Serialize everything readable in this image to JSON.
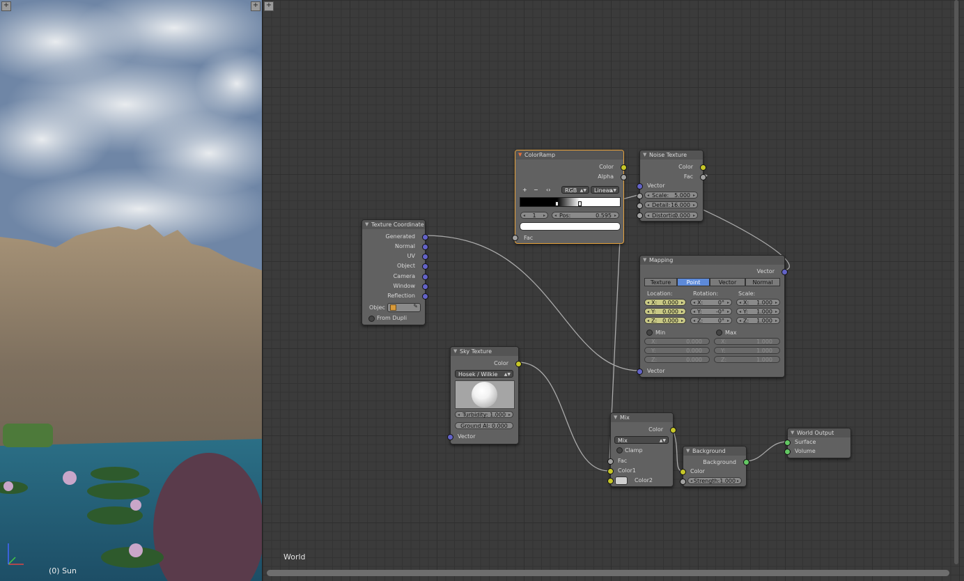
{
  "viewport": {
    "label": "(0) Sun"
  },
  "editor": {
    "world_label": "World"
  },
  "nodes": {
    "color_ramp": {
      "title": "ColorRamp",
      "out_color": "Color",
      "out_alpha": "Alpha",
      "btn_add": "+",
      "btn_remove": "−",
      "btn_flip": "‹›",
      "mode": "RGB",
      "interpolation": "Linear",
      "index": "1",
      "pos_label": "Pos:",
      "pos_value": "0.595",
      "in_fac": "Fac"
    },
    "noise_texture": {
      "title": "Noise Texture",
      "out_color": "Color",
      "out_fac": "Fac",
      "in_vector": "Vector",
      "scale_label": "Scale:",
      "scale_value": "5.000",
      "detail_label": "Detail:",
      "detail_value": "16.000",
      "distortion_label": "Distortio:",
      "distortion_value": "0.000"
    },
    "texture_coordinate": {
      "title": "Texture Coordinate",
      "outputs": [
        "Generated",
        "Normal",
        "UV",
        "Object",
        "Camera",
        "Window",
        "Reflection"
      ],
      "object_label": "Objec",
      "from_dupli": "From Dupli"
    },
    "mapping": {
      "title": "Mapping",
      "out_vector": "Vector",
      "tabs": [
        "Texture",
        "Point",
        "Vector",
        "Normal"
      ],
      "location_label": "Location:",
      "rotation_label": "Rotation:",
      "scale_label": "Scale:",
      "location": [
        [
          "X:",
          "0.000"
        ],
        [
          "Y:",
          "0.000"
        ],
        [
          "Z:",
          "0.000"
        ]
      ],
      "rotation": [
        [
          "X:",
          "0°"
        ],
        [
          "Y:",
          "-0°"
        ],
        [
          "Z:",
          "0°"
        ]
      ],
      "scale": [
        [
          "X:",
          "1.000"
        ],
        [
          "Y:",
          "1.000"
        ],
        [
          "Z:",
          "1.000"
        ]
      ],
      "min_label": "Min",
      "max_label": "Max",
      "min": [
        [
          "X:",
          "0.000"
        ],
        [
          "Y:",
          "0.000"
        ],
        [
          "Z:",
          "0.000"
        ]
      ],
      "max": [
        [
          "X:",
          "1.000"
        ],
        [
          "Y:",
          "1.000"
        ],
        [
          "Z:",
          "1.000"
        ]
      ],
      "in_vector": "Vector"
    },
    "sky_texture": {
      "title": "Sky Texture",
      "out_color": "Color",
      "model": "Hosek / Wilkie",
      "turbidity": "Turbidity: 1.000",
      "ground": "Ground Al: 0.000",
      "in_vector": "Vector"
    },
    "mix": {
      "title": "Mix",
      "out_color": "Color",
      "blend": "Mix",
      "clamp": "Clamp",
      "in_fac": "Fac",
      "in_color1": "Color1",
      "in_color2": "Color2"
    },
    "background": {
      "title": "Background",
      "out_background": "Background",
      "in_color": "Color",
      "strength": "Strength:1.000"
    },
    "world_output": {
      "title": "World Output",
      "in_surface": "Surface",
      "in_volume": "Volume"
    }
  },
  "colors": {
    "active_border": "#e8a33c",
    "socket_vector": "#6363c7",
    "socket_color": "#c7c729",
    "socket_float": "#a1a1a1",
    "socket_shader": "#63c763",
    "tab_active": "#5d8ad9"
  }
}
